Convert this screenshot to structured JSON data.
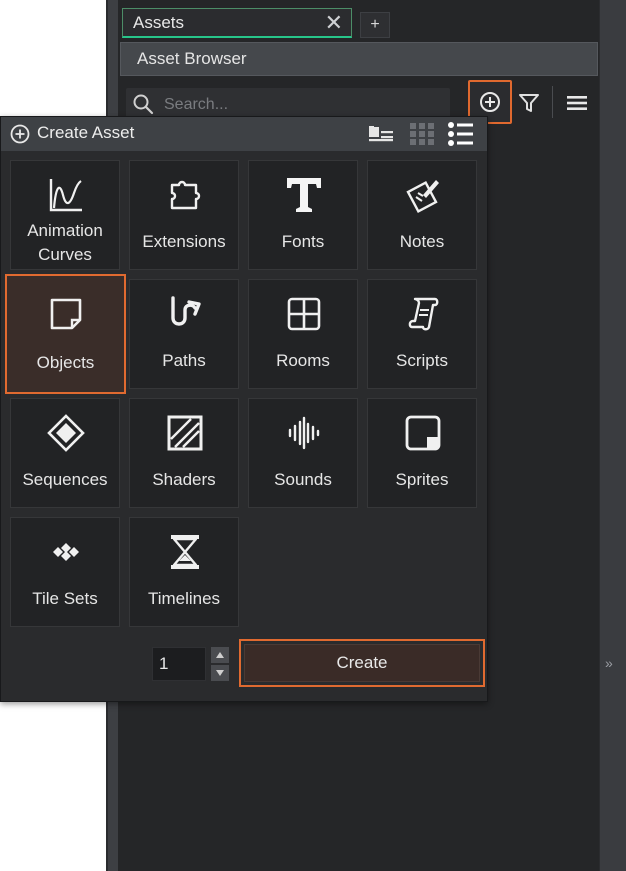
{
  "dock": {
    "tab_label": "Assets",
    "tab_close": "✕",
    "tab_add": "+",
    "browser_title": "Asset Browser",
    "search_placeholder": "Search...",
    "rail_chevron": "»"
  },
  "popup": {
    "title": "Create Asset",
    "tiles": [
      {
        "label": "Animation Curves",
        "icon": "animation-curve-icon"
      },
      {
        "label": "Extensions",
        "icon": "puzzle-icon"
      },
      {
        "label": "Fonts",
        "icon": "font-icon"
      },
      {
        "label": "Notes",
        "icon": "note-icon"
      },
      {
        "label": "Objects",
        "icon": "object-icon",
        "selected": true
      },
      {
        "label": "Paths",
        "icon": "path-icon"
      },
      {
        "label": "Rooms",
        "icon": "room-icon"
      },
      {
        "label": "Scripts",
        "icon": "script-icon"
      },
      {
        "label": "Sequences",
        "icon": "sequence-icon"
      },
      {
        "label": "Shaders",
        "icon": "shader-icon"
      },
      {
        "label": "Sounds",
        "icon": "sound-icon"
      },
      {
        "label": "Sprites",
        "icon": "sprite-icon"
      },
      {
        "label": "Tile Sets",
        "icon": "tileset-icon"
      },
      {
        "label": "Timelines",
        "icon": "timeline-icon"
      }
    ],
    "quantity": "1",
    "create_label": "Create"
  },
  "colors": {
    "accent_orange": "#e06a30",
    "tab_green": "#27c58a",
    "panel_bg": "#2a2b2d",
    "tile_bg": "#222325"
  }
}
